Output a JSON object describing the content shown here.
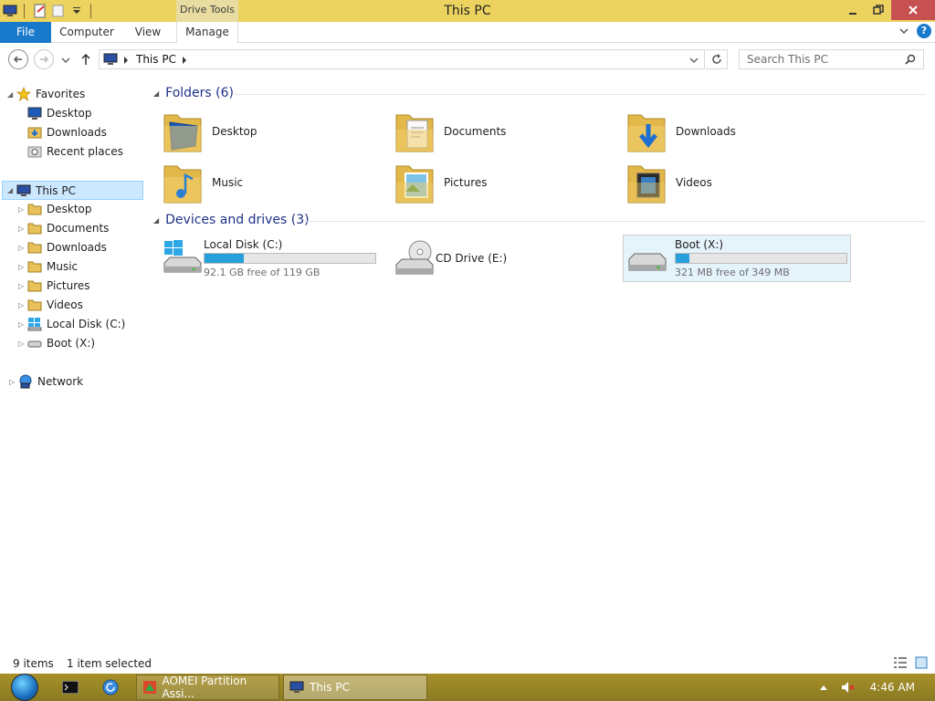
{
  "window": {
    "title": "This PC",
    "contextual_tab": "Drive Tools"
  },
  "ribbon": {
    "tabs": [
      {
        "label": "File"
      },
      {
        "label": "Computer"
      },
      {
        "label": "View"
      },
      {
        "label": "Manage"
      }
    ],
    "help_label": "?"
  },
  "address": {
    "path": "This PC",
    "search_placeholder": "Search This PC"
  },
  "navpane": {
    "favorites": {
      "label": "Favorites",
      "items": [
        {
          "label": "Desktop"
        },
        {
          "label": "Downloads"
        },
        {
          "label": "Recent places"
        }
      ]
    },
    "this_pc": {
      "label": "This PC",
      "items": [
        {
          "label": "Desktop"
        },
        {
          "label": "Documents"
        },
        {
          "label": "Downloads"
        },
        {
          "label": "Music"
        },
        {
          "label": "Pictures"
        },
        {
          "label": "Videos"
        },
        {
          "label": "Local Disk (C:)"
        },
        {
          "label": "Boot (X:)"
        }
      ]
    },
    "network": {
      "label": "Network"
    }
  },
  "content": {
    "folders_header": "Folders (6)",
    "folders": [
      {
        "name": "Desktop"
      },
      {
        "name": "Documents"
      },
      {
        "name": "Downloads"
      },
      {
        "name": "Music"
      },
      {
        "name": "Pictures"
      },
      {
        "name": "Videos"
      }
    ],
    "drives_header": "Devices and drives (3)",
    "drives": [
      {
        "name": "Local Disk (C:)",
        "free_text": "92.1 GB free of 119 GB",
        "used_fraction": 0.23
      },
      {
        "name": "CD Drive (E:)"
      },
      {
        "name": "Boot (X:)",
        "free_text": "321 MB free of 349 MB",
        "used_fraction": 0.08
      }
    ]
  },
  "status": {
    "items_count": "9 items",
    "selection": "1 item selected"
  },
  "taskbar": {
    "buttons": [
      {
        "label": "AOMEI Partition Assi..."
      },
      {
        "label": "This PC"
      }
    ],
    "clock": "4:46 AM"
  },
  "colors": {
    "accent": "#1979ca",
    "drive_bar": "#26a0da",
    "title_bar": "#ecd35f",
    "selection": "#cce8ff"
  }
}
